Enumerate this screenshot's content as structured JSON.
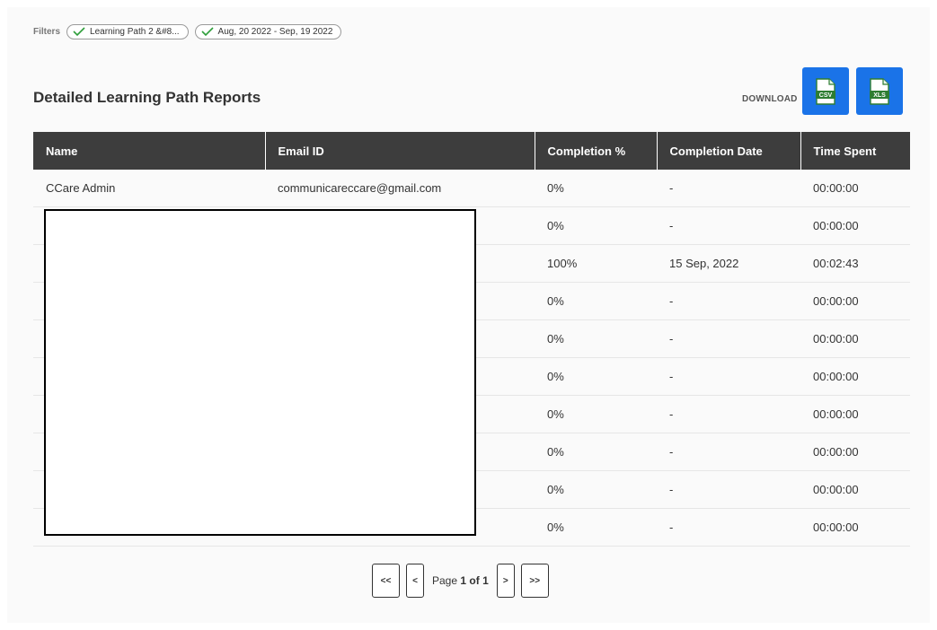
{
  "filters": {
    "label": "Filters",
    "chips": [
      {
        "label": "Learning Path 2 &#8..."
      },
      {
        "label": "Aug, 20 2022 - Sep, 19 2022"
      }
    ]
  },
  "page_title": "Detailed Learning Path Reports",
  "download": {
    "label": "DOWNLOAD",
    "csv_label": "CSV",
    "xls_label": "XLS",
    "csv_icon": "csv-file-icon",
    "xls_icon": "xls-file-icon",
    "button_color": "#1a73e8"
  },
  "table": {
    "columns": [
      "Name",
      "Email ID",
      "Completion %",
      "Completion Date",
      "Time Spent"
    ],
    "rows": [
      {
        "name": "CCare Admin",
        "email": "communicareccare@gmail.com",
        "completion": "0%",
        "date": "-",
        "time": "00:00:00"
      },
      {
        "name": "",
        "email": "",
        "completion": "0%",
        "date": "-",
        "time": "00:00:00"
      },
      {
        "name": "",
        "email": "",
        "completion": "100%",
        "date": "15 Sep, 2022",
        "time": "00:02:43"
      },
      {
        "name": "",
        "email": "",
        "completion": "0%",
        "date": "-",
        "time": "00:00:00"
      },
      {
        "name": "",
        "email": "",
        "completion": "0%",
        "date": "-",
        "time": "00:00:00"
      },
      {
        "name": "",
        "email": "",
        "completion": "0%",
        "date": "-",
        "time": "00:00:00"
      },
      {
        "name": "",
        "email": "",
        "completion": "0%",
        "date": "-",
        "time": "00:00:00"
      },
      {
        "name": "",
        "email": "",
        "completion": "0%",
        "date": "-",
        "time": "00:00:00"
      },
      {
        "name": "",
        "email": "",
        "completion": "0%",
        "date": "-",
        "time": "00:00:00"
      },
      {
        "name": "",
        "email": "",
        "completion": "0%",
        "date": "-",
        "time": "00:00:00"
      }
    ],
    "header_color": "#3d3d3d"
  },
  "pagination": {
    "first_label": "<<",
    "prev_label": "<",
    "page_prefix": "Page",
    "current_page": "1",
    "of_word": "of",
    "total_pages": "1",
    "next_label": ">",
    "last_label": ">>"
  }
}
